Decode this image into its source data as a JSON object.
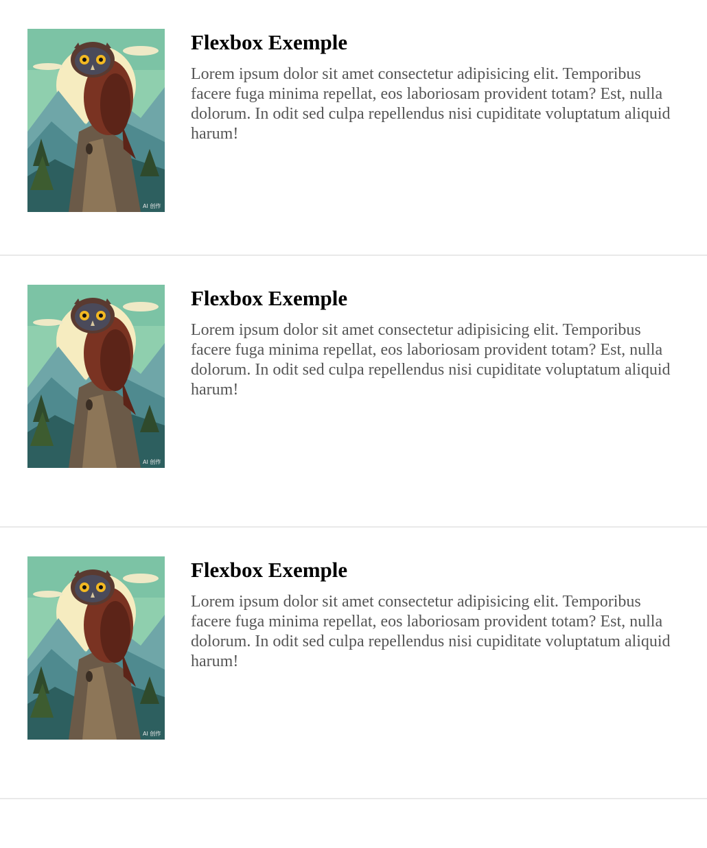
{
  "cards": [
    {
      "image": {
        "icon": "owl-illustration",
        "watermark": "AI 创作"
      },
      "title": "Flexbox Exemple",
      "text": "Lorem ipsum dolor sit amet consectetur adipisicing elit. Temporibus facere fuga minima repellat, eos laboriosam provident totam? Est, nulla dolorum. In odit sed culpa repellendus nisi cupiditate voluptatum aliquid harum!"
    },
    {
      "image": {
        "icon": "owl-illustration",
        "watermark": "AI 创作"
      },
      "title": "Flexbox Exemple",
      "text": "Lorem ipsum dolor sit amet consectetur adipisicing elit. Temporibus facere fuga minima repellat, eos laboriosam provident totam? Est, nulla dolorum. In odit sed culpa repellendus nisi cupiditate voluptatum aliquid harum!"
    },
    {
      "image": {
        "icon": "owl-illustration",
        "watermark": "AI 创作"
      },
      "title": "Flexbox Exemple",
      "text": "Lorem ipsum dolor sit amet consectetur adipisicing elit. Temporibus facere fuga minima repellat, eos laboriosam provident totam? Est, nulla dolorum. In odit sed culpa repellendus nisi cupiditate voluptatum aliquid harum!"
    }
  ],
  "colors": {
    "title": "#000000",
    "text": "#555555",
    "divider": "#e9e9e9",
    "sky": "#8fcfae",
    "moon": "#f6ecc0",
    "mountain": "#6fa6a8",
    "owl": "#7a3322"
  }
}
